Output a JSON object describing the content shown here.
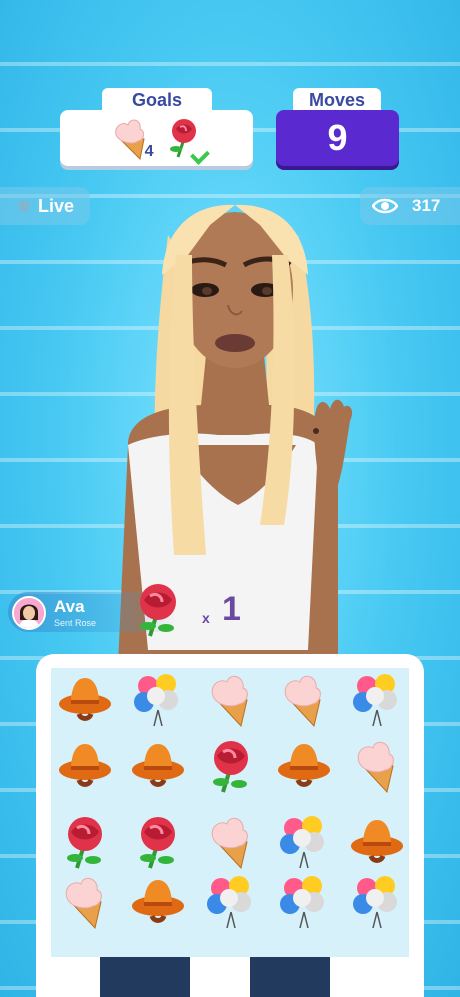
{
  "hud": {
    "goals_label": "Goals",
    "goals": [
      {
        "item": "ice-cream-icon",
        "count": "4"
      },
      {
        "item": "rose-icon",
        "status": "done"
      }
    ],
    "moves_label": "Moves",
    "moves_value": "9"
  },
  "stream": {
    "live_label": "Live",
    "viewers": "317"
  },
  "gift": {
    "sender": "Ava",
    "subtitle": "Sent Rose",
    "item": "rose-icon",
    "multiplier": "x",
    "count": "1"
  },
  "board": {
    "rows": [
      [
        "hat",
        "balloons",
        "ice-cream",
        "ice-cream",
        "balloons"
      ],
      [
        "hat",
        "hat",
        "rose",
        "hat",
        "ice-cream"
      ],
      [
        "rose",
        "rose",
        "ice-cream",
        "balloons",
        "hat"
      ],
      [
        "ice-cream",
        "hat",
        "balloons",
        "balloons",
        "balloons"
      ]
    ]
  },
  "colors": {
    "moves_bg": "#5a2ad0",
    "label_text": "#3a4aa0",
    "background": "#46c8f2"
  }
}
